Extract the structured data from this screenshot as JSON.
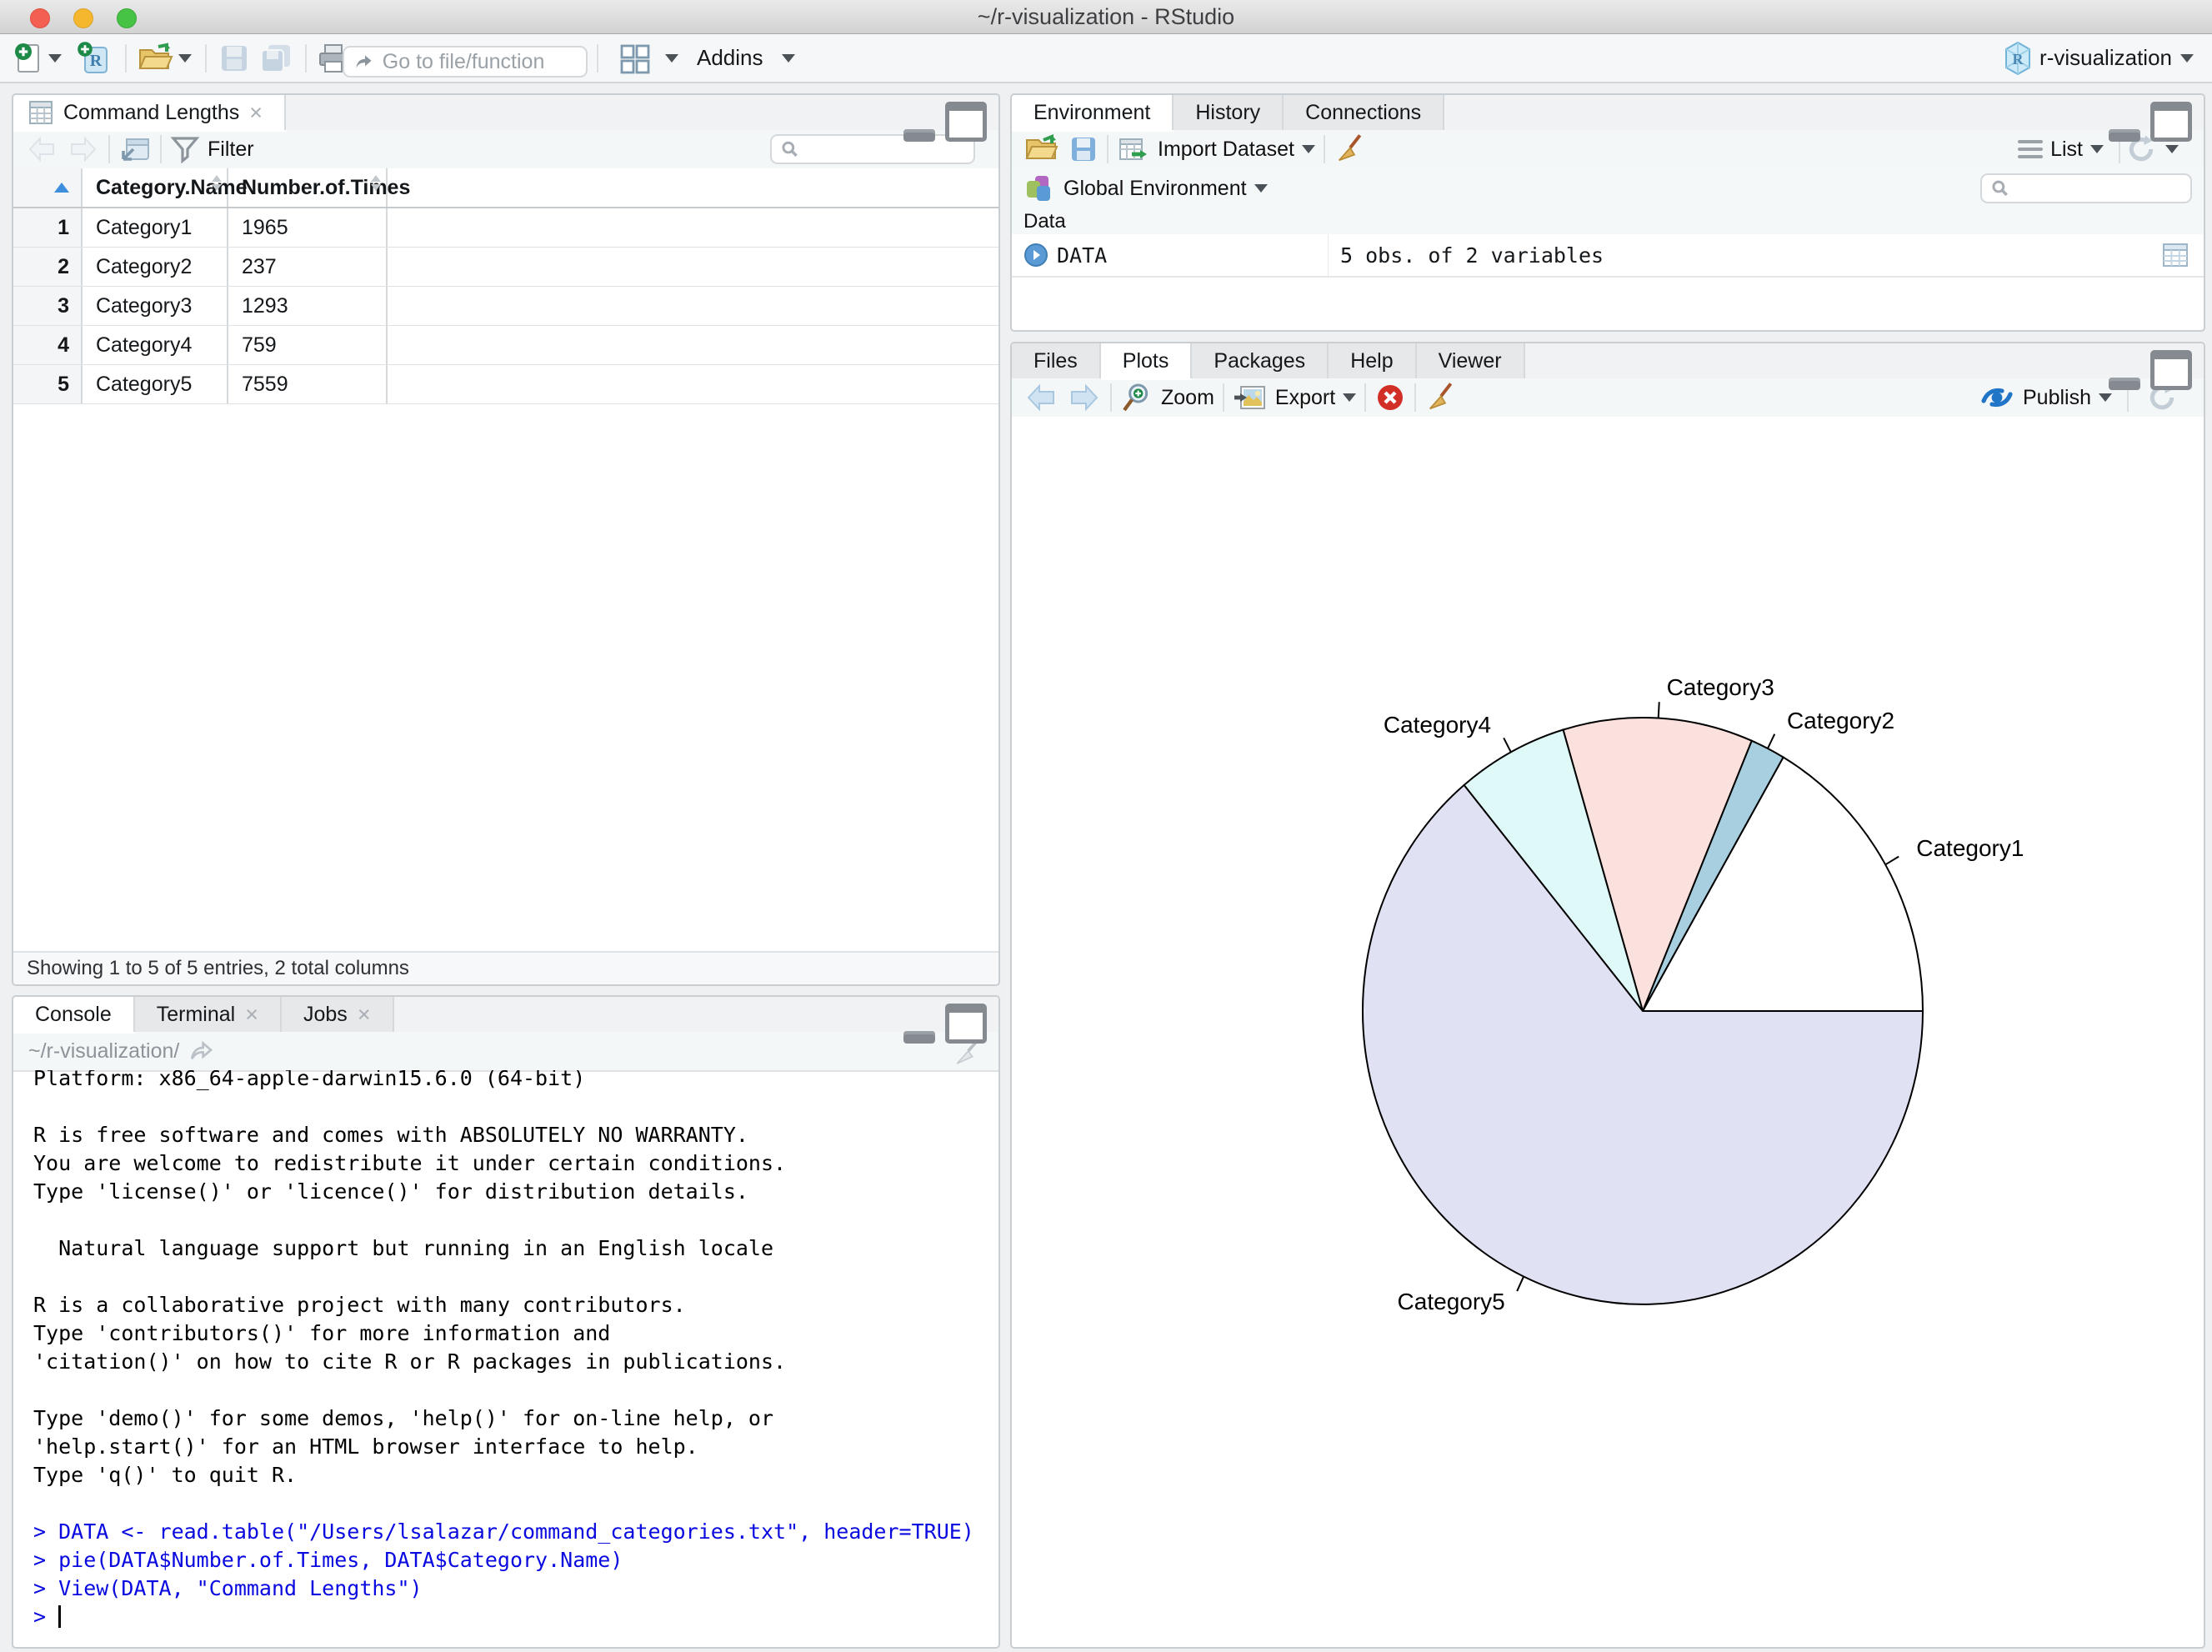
{
  "window": {
    "title": "~/r-visualization - RStudio"
  },
  "main_toolbar": {
    "goto_placeholder": "Go to file/function",
    "addins_label": "Addins",
    "project_label": "r-visualization"
  },
  "viewer_pane": {
    "tab": "Command Lengths",
    "filter_label": "Filter",
    "columns": [
      "Category.Name",
      "Number.of.Times"
    ],
    "rows": [
      [
        "1",
        "Category1",
        "1965"
      ],
      [
        "2",
        "Category2",
        "237"
      ],
      [
        "3",
        "Category3",
        "1293"
      ],
      [
        "4",
        "Category4",
        "759"
      ],
      [
        "5",
        "Category5",
        "7559"
      ]
    ],
    "status": "Showing 1 to 5 of 5 entries, 2 total columns"
  },
  "environment_pane": {
    "tabs": [
      "Environment",
      "History",
      "Connections"
    ],
    "import_label": "Import Dataset",
    "list_label": "List",
    "scope_label": "Global Environment",
    "section_label": "Data",
    "object_name": "DATA",
    "object_desc": "5 obs. of 2 variables"
  },
  "plots_pane": {
    "tabs": [
      "Files",
      "Plots",
      "Packages",
      "Help",
      "Viewer"
    ],
    "zoom_label": "Zoom",
    "export_label": "Export",
    "publish_label": "Publish"
  },
  "console_pane": {
    "tabs": [
      "Console",
      "Terminal",
      "Jobs"
    ],
    "cwd": "~/r-visualization/",
    "lines": [
      {
        "t": "Platform: x86_64-apple-darwin15.6.0 (64-bit)",
        "k": "out"
      },
      {
        "t": "",
        "k": "out"
      },
      {
        "t": "R is free software and comes with ABSOLUTELY NO WARRANTY.",
        "k": "out"
      },
      {
        "t": "You are welcome to redistribute it under certain conditions.",
        "k": "out"
      },
      {
        "t": "Type 'license()' or 'licence()' for distribution details.",
        "k": "out"
      },
      {
        "t": "",
        "k": "out"
      },
      {
        "t": "  Natural language support but running in an English locale",
        "k": "out"
      },
      {
        "t": "",
        "k": "out"
      },
      {
        "t": "R is a collaborative project with many contributors.",
        "k": "out"
      },
      {
        "t": "Type 'contributors()' for more information and",
        "k": "out"
      },
      {
        "t": "'citation()' on how to cite R or R packages in publications.",
        "k": "out"
      },
      {
        "t": "",
        "k": "out"
      },
      {
        "t": "Type 'demo()' for some demos, 'help()' for on-line help, or",
        "k": "out"
      },
      {
        "t": "'help.start()' for an HTML browser interface to help.",
        "k": "out"
      },
      {
        "t": "Type 'q()' to quit R.",
        "k": "out"
      },
      {
        "t": "",
        "k": "out"
      },
      {
        "t": "> DATA <- read.table(\"/Users/lsalazar/command_categories.txt\", header=TRUE)",
        "k": "in"
      },
      {
        "t": "> pie(DATA$Number.of.Times, DATA$Category.Name)",
        "k": "in"
      },
      {
        "t": "> View(DATA, \"Command Lengths\")",
        "k": "in"
      },
      {
        "t": "> ",
        "k": "in",
        "cursor": true
      }
    ]
  },
  "chart_data": {
    "type": "pie",
    "title": "",
    "categories": [
      "Category1",
      "Category2",
      "Category3",
      "Category4",
      "Category5"
    ],
    "values": [
      1965,
      237,
      1293,
      759,
      7559
    ],
    "colors": [
      "#FFFFFF",
      "#A7CFE0",
      "#FBE1DD",
      "#DFF8F8",
      "#E1E1F4"
    ],
    "stroke_color": "#000000",
    "label_color": "#000000",
    "start_angle_deg": 0,
    "direction": "counterclockwise",
    "legend": "none"
  }
}
